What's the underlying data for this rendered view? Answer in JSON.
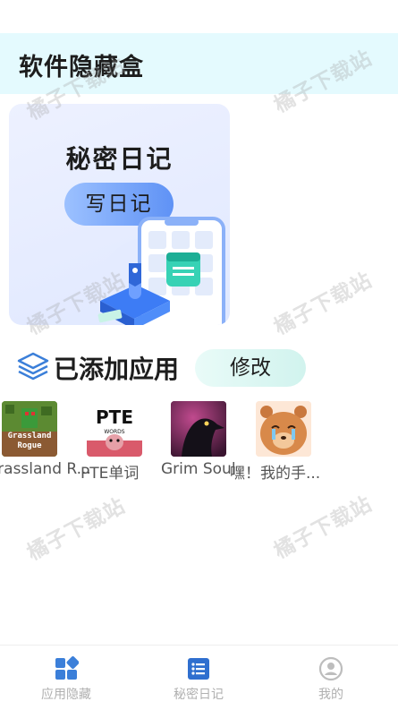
{
  "header": {
    "title": "软件隐藏盒"
  },
  "diary_card": {
    "title": "秘密日记",
    "write_button": "写日记"
  },
  "apps_section": {
    "title": "已添加应用",
    "edit_button": "修改"
  },
  "apps": [
    {
      "label": "Grassland R...",
      "icon_text_1": "Grassland",
      "icon_text_2": "Rogue"
    },
    {
      "label": "PTE单词",
      "icon_text_1": "PTE",
      "icon_text_2": "WORDS"
    },
    {
      "label": "Grim Soul"
    },
    {
      "label": "嘿！我的手..."
    }
  ],
  "tabs": [
    {
      "label": "应用隐藏",
      "icon": "apps-grid-icon",
      "active": true
    },
    {
      "label": "秘密日记",
      "icon": "diary-list-icon",
      "active": false
    },
    {
      "label": "我的",
      "icon": "profile-icon",
      "active": false
    }
  ],
  "watermark": "橘子下载站",
  "colors": {
    "accent": "#3b7fd9",
    "header_bg": "#e4fafe",
    "tab_inactive": "#b0b0b0"
  }
}
